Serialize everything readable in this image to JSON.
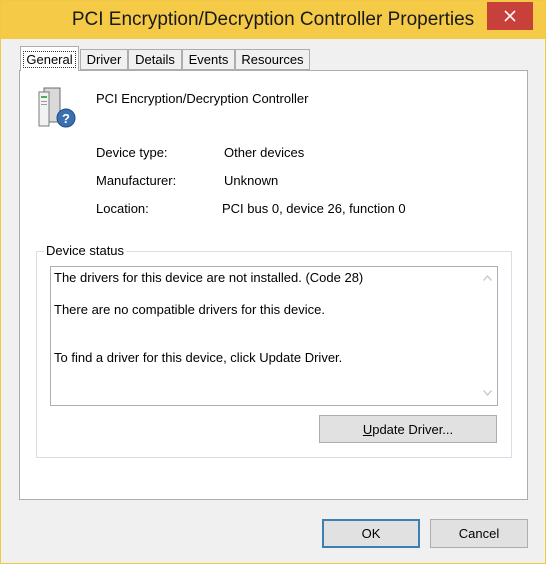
{
  "window": {
    "title": "PCI Encryption/Decryption Controller Properties"
  },
  "tabs": [
    {
      "label": "General",
      "active": true
    },
    {
      "label": "Driver"
    },
    {
      "label": "Details"
    },
    {
      "label": "Events"
    },
    {
      "label": "Resources"
    }
  ],
  "device": {
    "name": "PCI Encryption/Decryption Controller",
    "icon": "unknown-device-icon",
    "properties": [
      {
        "label": "Device type:",
        "value": "Other devices"
      },
      {
        "label": "Manufacturer:",
        "value": "Unknown"
      },
      {
        "label": "Location:",
        "value": "PCI bus 0, device 26, function 0"
      }
    ]
  },
  "status": {
    "title": "Device status",
    "lines": [
      "The drivers for this device are not installed. (Code 28)",
      "There are no compatible drivers for this device.",
      "To find a driver for this device, click Update Driver."
    ]
  },
  "buttons": {
    "update_driver_mnemonic": "U",
    "update_driver_rest": "pdate Driver...",
    "ok": "OK",
    "cancel": "Cancel"
  },
  "colors": {
    "titlebar": "#f4ca47",
    "close": "#c7403a"
  }
}
